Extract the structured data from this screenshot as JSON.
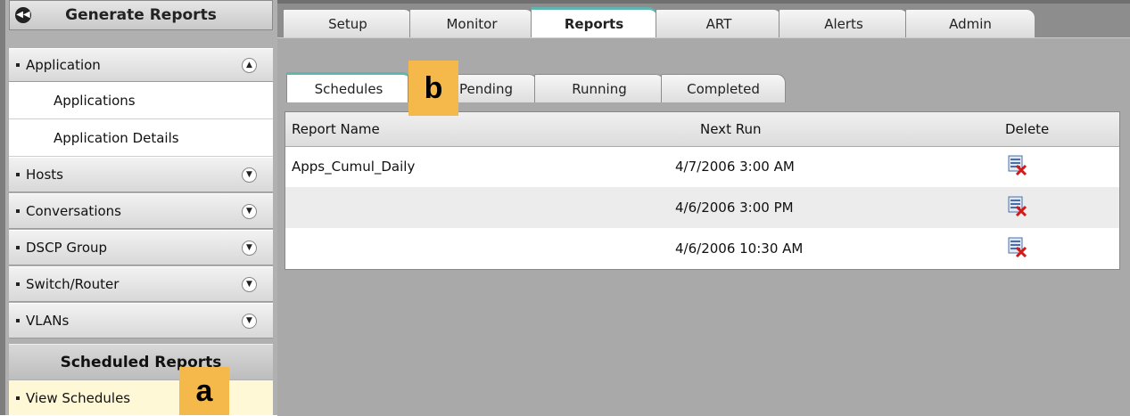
{
  "sidebar": {
    "title": "Generate Reports",
    "application_section": {
      "label": "Application",
      "items": [
        "Applications",
        "Application Details"
      ]
    },
    "sections": [
      "Hosts",
      "Conversations",
      "DSCP Group",
      "Switch/Router",
      "VLANs"
    ],
    "scheduled_header": "Scheduled Reports",
    "view_schedules": "View Schedules"
  },
  "callouts": {
    "a": "a",
    "b": "b"
  },
  "top_tabs": [
    "Setup",
    "Monitor",
    "Reports",
    "ART",
    "Alerts",
    "Admin"
  ],
  "active_top_tab": "Reports",
  "sub_tabs": [
    "Schedules",
    "Pending",
    "Running",
    "Completed"
  ],
  "active_sub_tab": "Schedules",
  "table": {
    "headers": {
      "name": "Report Name",
      "next_run": "Next Run",
      "delete": "Delete"
    },
    "rows": [
      {
        "name": "Apps_Cumul_Daily",
        "next_run": "4/7/2006 3:00 AM"
      },
      {
        "name": "",
        "next_run": "4/6/2006 3:00 PM"
      },
      {
        "name": "",
        "next_run": "4/6/2006 10:30 AM"
      }
    ]
  },
  "colors": {
    "active_tab_accent": "#5fb5b0",
    "callout": "#f4b94a",
    "delete_x": "#d11a1a"
  }
}
